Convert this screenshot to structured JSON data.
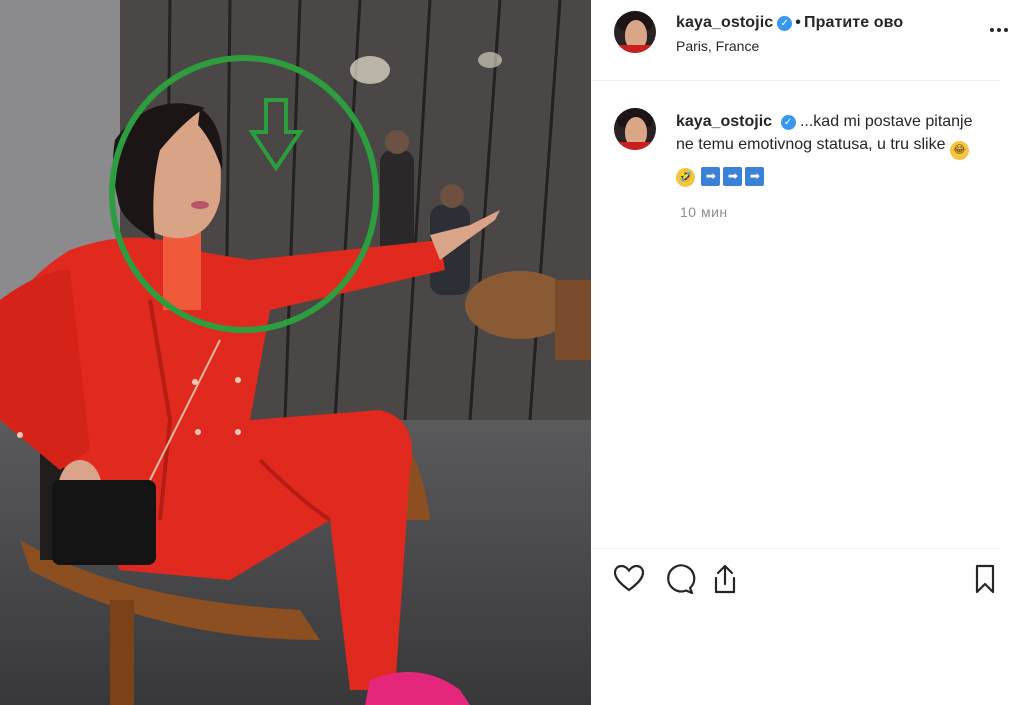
{
  "post": {
    "username": "kaya_ostojic",
    "follow_label": "Пратите ово",
    "separator": "•",
    "location": "Paris, France",
    "verified_icon": "✓",
    "caption_user": "kaya_ostojic",
    "caption_text": "...kad mi postave pitanje ne temu emotivnog statusa, u tru slike",
    "caption_emojis": [
      "😂",
      "🤣"
    ],
    "caption_arrow_icon": "➡",
    "caption_arrows": [
      "➡",
      "➡",
      "➡"
    ],
    "time_ago": "10 мин"
  },
  "icons": {
    "more": "more-options-icon",
    "like": "heart-icon",
    "comment": "comment-icon",
    "share": "share-icon",
    "save": "bookmark-icon"
  },
  "colors": {
    "suit_red": "#e02a1f",
    "annotation_green": "#2e9d3f",
    "verified_blue": "#3897f0",
    "text_dark": "#262626",
    "text_muted": "#8e8e8e"
  }
}
